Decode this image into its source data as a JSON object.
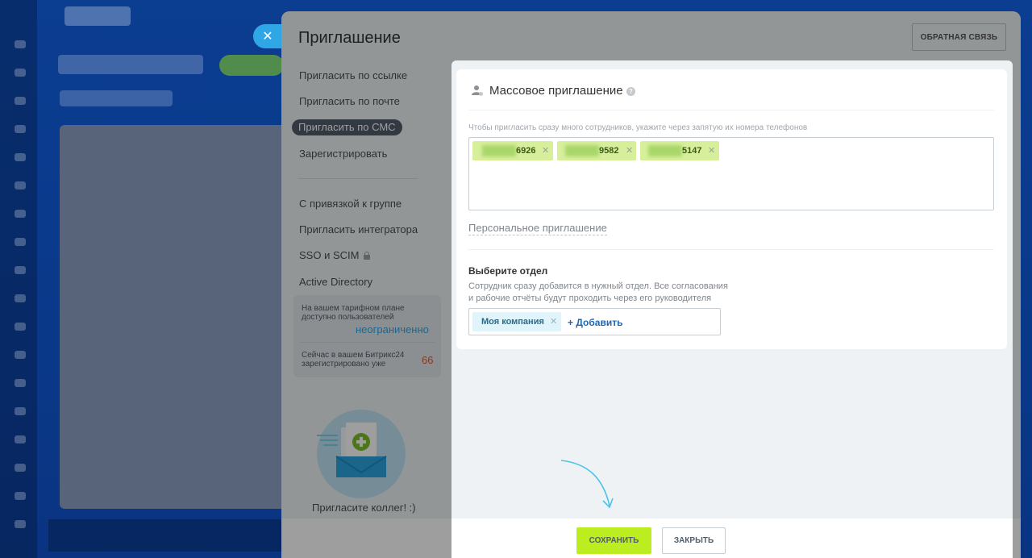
{
  "slider": {
    "title": "Приглашение",
    "feedback_button": "ОБРАТНАЯ СВЯЗЬ"
  },
  "nav": {
    "items": [
      "Пригласить по ссылке",
      "Пригласить по почте",
      "Пригласить по СМС",
      "Зарегистрировать",
      "С привязкой к группе",
      "Пригласить интегратора",
      "SSO и SCIM",
      "Active Directory"
    ],
    "active_index": 2
  },
  "info": {
    "plan_text": "На вашем тарифном плане доступно пользователей",
    "plan_value": "неограниченно",
    "registered_text": "Сейчас в вашем Битрикс24 зарегистрировано уже",
    "registered_value": "66"
  },
  "illustration": {
    "caption": "Пригласите коллег! :)"
  },
  "mass_invite": {
    "title": "Массовое приглашение",
    "hint": "Чтобы пригласить сразу много сотрудников, укажите через запятую их номера телефонов",
    "phones": [
      "6926",
      "9582",
      "5147"
    ],
    "personal_link": "Персональное приглашение"
  },
  "department": {
    "title": "Выберите отдел",
    "description": "Сотрудник сразу добавится в нужный отдел. Все согласования и рабочие отчёты будут проходить через его руководителя",
    "selected": "Моя компания",
    "add_label": "+ Добавить"
  },
  "footer": {
    "save": "СОХРАНИТЬ",
    "close": "ЗАКРЫТЬ"
  },
  "colors": {
    "accent_green": "#bbed21",
    "phone_tag": "#d7ef9a",
    "link_blue": "#2067b0",
    "unlimited_blue": "#2fa7e6",
    "count_red": "#e4572e"
  }
}
